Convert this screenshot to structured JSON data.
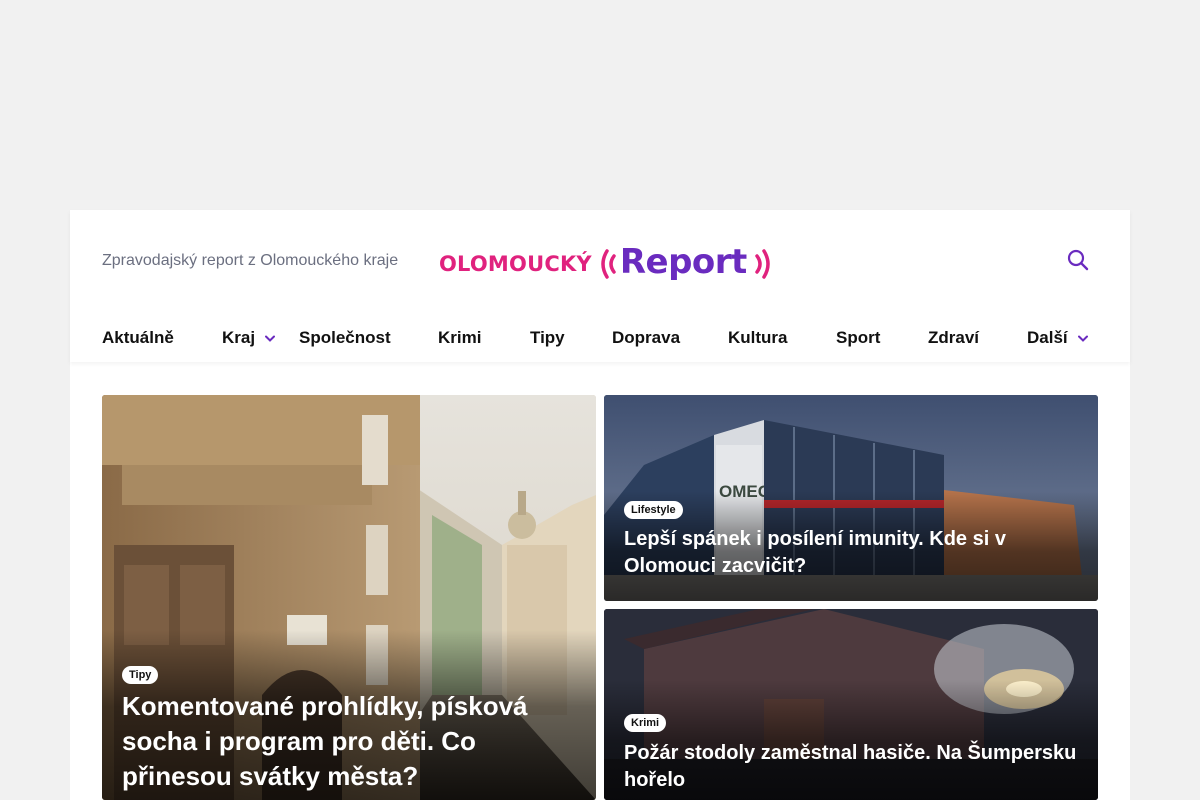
{
  "header": {
    "tagline": "Zpravodajský report z Olomouckého kraje",
    "logo": {
      "word": "OLOMOUCKÝ",
      "brand": "Report",
      "word_color": "#e0227e",
      "brand_color": "#6a2bbf"
    },
    "search_icon": "search-icon"
  },
  "nav": {
    "items": [
      {
        "label": "Aktuálně",
        "has_dropdown": false
      },
      {
        "label": "Kraj",
        "has_dropdown": true
      },
      {
        "label": "Společnost",
        "has_dropdown": false
      },
      {
        "label": "Krimi",
        "has_dropdown": false
      },
      {
        "label": "Tipy",
        "has_dropdown": false
      },
      {
        "label": "Doprava",
        "has_dropdown": false
      },
      {
        "label": "Kultura",
        "has_dropdown": false
      },
      {
        "label": "Sport",
        "has_dropdown": false
      },
      {
        "label": "Zdraví",
        "has_dropdown": false
      },
      {
        "label": "Další",
        "has_dropdown": true
      }
    ],
    "chevron_color": "#6a2bbf"
  },
  "articles": {
    "featured": {
      "category": "Tipy",
      "title": "Komentované prohlídky, písková socha i program pro děti. Co přinesou svátky města?"
    },
    "side_top": {
      "category": "Lifestyle",
      "title": "Lepší spánek i posílení imunity. Kde si v Olomouci zacvičit?",
      "sign_text": "OMEGA"
    },
    "side_bottom": {
      "category": "Krimi",
      "title": "Požár stodoly zaměstnal hasiče. Na Šumpersku hořelo"
    }
  }
}
